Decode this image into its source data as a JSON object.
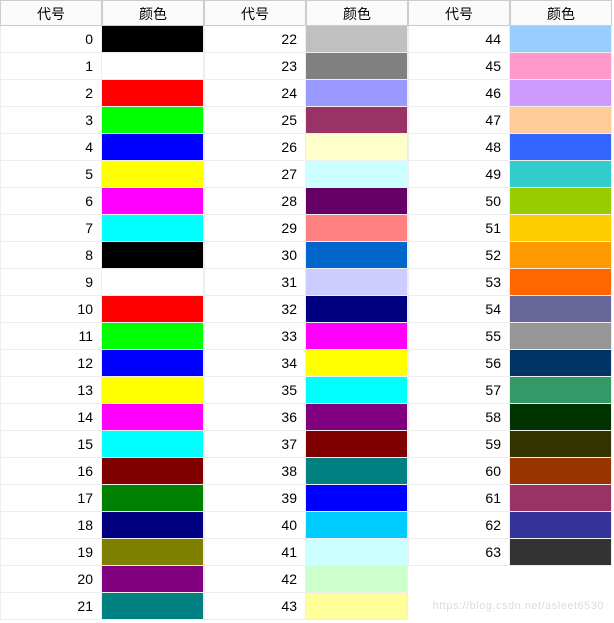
{
  "headers": {
    "code": "代号",
    "color": "颜色"
  },
  "watermark": "https://blog.csdn.net/asleet6530",
  "columns": [
    {
      "rows": [
        {
          "code": "0",
          "color": "#000000"
        },
        {
          "code": "1",
          "color": "#FFFFFF"
        },
        {
          "code": "2",
          "color": "#FF0000"
        },
        {
          "code": "3",
          "color": "#00FF00"
        },
        {
          "code": "4",
          "color": "#0000FF"
        },
        {
          "code": "5",
          "color": "#FFFF00"
        },
        {
          "code": "6",
          "color": "#FF00FF"
        },
        {
          "code": "7",
          "color": "#00FFFF"
        },
        {
          "code": "8",
          "color": "#000000"
        },
        {
          "code": "9",
          "color": "#FFFFFF"
        },
        {
          "code": "10",
          "color": "#FF0000"
        },
        {
          "code": "11",
          "color": "#00FF00"
        },
        {
          "code": "12",
          "color": "#0000FF"
        },
        {
          "code": "13",
          "color": "#FFFF00"
        },
        {
          "code": "14",
          "color": "#FF00FF"
        },
        {
          "code": "15",
          "color": "#00FFFF"
        },
        {
          "code": "16",
          "color": "#800000"
        },
        {
          "code": "17",
          "color": "#008000"
        },
        {
          "code": "18",
          "color": "#000080"
        },
        {
          "code": "19",
          "color": "#808000"
        },
        {
          "code": "20",
          "color": "#800080"
        },
        {
          "code": "21",
          "color": "#008080"
        }
      ]
    },
    {
      "rows": [
        {
          "code": "22",
          "color": "#C0C0C0"
        },
        {
          "code": "23",
          "color": "#808080"
        },
        {
          "code": "24",
          "color": "#9999FF"
        },
        {
          "code": "25",
          "color": "#993366"
        },
        {
          "code": "26",
          "color": "#FFFFCC"
        },
        {
          "code": "27",
          "color": "#CCFFFF"
        },
        {
          "code": "28",
          "color": "#660066"
        },
        {
          "code": "29",
          "color": "#FF8080"
        },
        {
          "code": "30",
          "color": "#0066CC"
        },
        {
          "code": "31",
          "color": "#CCCCFF"
        },
        {
          "code": "32",
          "color": "#000080"
        },
        {
          "code": "33",
          "color": "#FF00FF"
        },
        {
          "code": "34",
          "color": "#FFFF00"
        },
        {
          "code": "35",
          "color": "#00FFFF"
        },
        {
          "code": "36",
          "color": "#800080"
        },
        {
          "code": "37",
          "color": "#800000"
        },
        {
          "code": "38",
          "color": "#008080"
        },
        {
          "code": "39",
          "color": "#0000FF"
        },
        {
          "code": "40",
          "color": "#00CCFF"
        },
        {
          "code": "41",
          "color": "#CCFFFF"
        },
        {
          "code": "42",
          "color": "#CCFFCC"
        },
        {
          "code": "43",
          "color": "#FFFF99"
        }
      ]
    },
    {
      "rows": [
        {
          "code": "44",
          "color": "#99CCFF"
        },
        {
          "code": "45",
          "color": "#FF99CC"
        },
        {
          "code": "46",
          "color": "#CC99FF"
        },
        {
          "code": "47",
          "color": "#FFCC99"
        },
        {
          "code": "48",
          "color": "#3366FF"
        },
        {
          "code": "49",
          "color": "#33CCCC"
        },
        {
          "code": "50",
          "color": "#99CC00"
        },
        {
          "code": "51",
          "color": "#FFCC00"
        },
        {
          "code": "52",
          "color": "#FF9900"
        },
        {
          "code": "53",
          "color": "#FF6600"
        },
        {
          "code": "54",
          "color": "#666699"
        },
        {
          "code": "55",
          "color": "#969696"
        },
        {
          "code": "56",
          "color": "#003366"
        },
        {
          "code": "57",
          "color": "#339966"
        },
        {
          "code": "58",
          "color": "#003300"
        },
        {
          "code": "59",
          "color": "#333300"
        },
        {
          "code": "60",
          "color": "#993300"
        },
        {
          "code": "61",
          "color": "#993366"
        },
        {
          "code": "62",
          "color": "#333399"
        },
        {
          "code": "63",
          "color": "#333333"
        }
      ]
    }
  ]
}
